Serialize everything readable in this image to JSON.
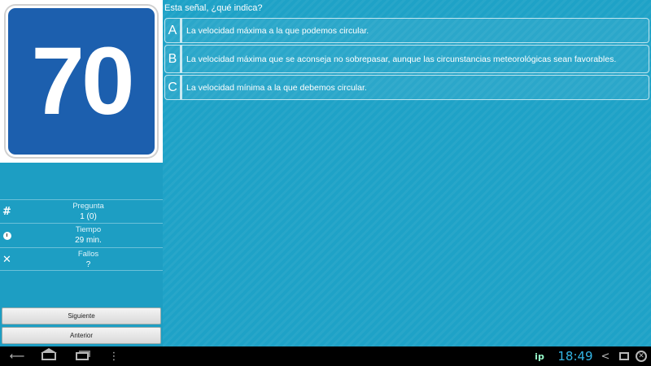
{
  "sign": {
    "number": "70"
  },
  "question": "Esta señal, ¿qué indica?",
  "options": [
    {
      "letter": "A",
      "text": "La velocidad máxima a la que podemos circular."
    },
    {
      "letter": "B",
      "text": "La velocidad máxima que se aconseja no sobrepasar, aunque las circunstancias meteorológicas sean favorables."
    },
    {
      "letter": "C",
      "text": "La velocidad mínima a la que debemos circular."
    }
  ],
  "stats": {
    "pregunta": {
      "icon": "hash-icon",
      "label": "Pregunta",
      "value": "1 (0)"
    },
    "tiempo": {
      "icon": "clock-icon",
      "label": "Tiempo",
      "value": "29 min."
    },
    "fallos": {
      "icon": "x-icon",
      "label": "Fallos",
      "value": "?"
    }
  },
  "buttons": {
    "siguiente": "Siguiente",
    "anterior": "Anterior"
  },
  "navbar": {
    "ip": "ip",
    "time": "18:49"
  },
  "colors": {
    "background": "#1ea2c7",
    "sign_blue": "#1c5fae",
    "clock_accent": "#33b5e5"
  }
}
